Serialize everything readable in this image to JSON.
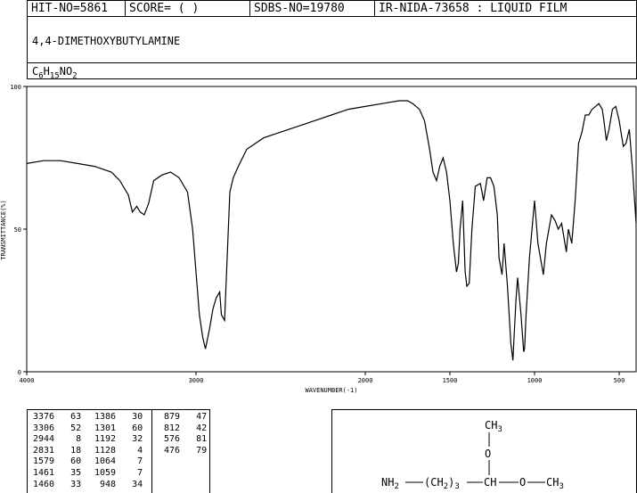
{
  "header": {
    "hit_no": "HIT-NO=5861",
    "score": "SCORE=  (   )",
    "sdbs_no": "SDBS-NO=19780",
    "ir_nida": "IR-NIDA-73658 : LIQUID FILM"
  },
  "compound": {
    "name": "4,4-DIMETHOXYBUTYLAMINE",
    "formula": {
      "C": "C",
      "c_n": "6",
      "H": "H",
      "h_n": "15",
      "N": "N",
      "O": "O",
      "o_n": "2"
    }
  },
  "chart_data": {
    "type": "line",
    "xlabel": "WAVENUMBER(-1)",
    "ylabel": "TRANSMITTANCE(%)",
    "xlim": [
      4000,
      400
    ],
    "ylim": [
      0,
      100
    ],
    "x_ticks": [
      4000,
      3000,
      2000,
      1500,
      1000,
      500
    ],
    "y_ticks": [
      0,
      50,
      100
    ],
    "series": [
      {
        "x": [
          4000,
          3900,
          3800,
          3700,
          3600,
          3500,
          3450,
          3400,
          3376,
          3350,
          3330,
          3306,
          3280,
          3250,
          3200,
          3150,
          3100,
          3050,
          3020,
          3000,
          2980,
          2960,
          2944,
          2920,
          2900,
          2880,
          2860,
          2850,
          2831,
          2800,
          2780,
          2750,
          2700,
          2600,
          2500,
          2400,
          2300,
          2200,
          2100,
          2000,
          1900,
          1800,
          1750,
          1720,
          1700,
          1680,
          1650,
          1620,
          1600,
          1579,
          1560,
          1540,
          1520,
          1500,
          1480,
          1461,
          1450,
          1440,
          1425,
          1410,
          1400,
          1386,
          1370,
          1350,
          1320,
          1301,
          1280,
          1260,
          1240,
          1220,
          1210,
          1192,
          1180,
          1160,
          1140,
          1128,
          1110,
          1100,
          1080,
          1064,
          1059,
          1050,
          1030,
          1000,
          980,
          948,
          930,
          900,
          879,
          860,
          840,
          812,
          800,
          780,
          760,
          740,
          720,
          700,
          680,
          660,
          640,
          620,
          600,
          590,
          576,
          560,
          540,
          520,
          500,
          476,
          460,
          440,
          420,
          400
        ],
        "y": [
          73,
          74,
          74,
          73,
          72,
          70,
          67,
          62,
          56,
          58,
          56,
          55,
          59,
          67,
          69,
          70,
          68,
          63,
          50,
          35,
          20,
          12,
          8,
          15,
          22,
          26,
          28,
          20,
          18,
          63,
          68,
          72,
          78,
          82,
          84,
          86,
          88,
          90,
          92,
          93,
          94,
          95,
          95,
          94,
          93,
          92,
          88,
          78,
          70,
          67,
          72,
          75,
          70,
          60,
          45,
          35,
          38,
          50,
          60,
          35,
          30,
          31,
          50,
          65,
          66,
          60,
          68,
          68,
          65,
          55,
          40,
          34,
          45,
          30,
          10,
          4,
          25,
          33,
          20,
          7,
          8,
          20,
          40,
          60,
          45,
          34,
          45,
          55,
          53,
          50,
          52,
          42,
          50,
          45,
          60,
          80,
          84,
          90,
          90,
          92,
          93,
          94,
          92,
          88,
          81,
          85,
          92,
          93,
          88,
          79,
          80,
          85,
          70,
          52
        ]
      }
    ],
    "peaks": [
      {
        "wavenumber": 3376,
        "t": 63
      },
      {
        "wavenumber": 3306,
        "t": 52
      },
      {
        "wavenumber": 2944,
        "t": 8
      },
      {
        "wavenumber": 2831,
        "t": 18
      },
      {
        "wavenumber": 1579,
        "t": 60
      },
      {
        "wavenumber": 1461,
        "t": 35
      },
      {
        "wavenumber": 1460,
        "t": 33
      },
      {
        "wavenumber": 1386,
        "t": 30
      },
      {
        "wavenumber": 1301,
        "t": 60
      },
      {
        "wavenumber": 1192,
        "t": 32
      },
      {
        "wavenumber": 1128,
        "t": 4
      },
      {
        "wavenumber": 1064,
        "t": 7
      },
      {
        "wavenumber": 1059,
        "t": 7
      },
      {
        "wavenumber": 948,
        "t": 34
      },
      {
        "wavenumber": 879,
        "t": 47
      },
      {
        "wavenumber": 812,
        "t": 42
      },
      {
        "wavenumber": 576,
        "t": 81
      },
      {
        "wavenumber": 476,
        "t": 79
      }
    ]
  },
  "structure": {
    "top_group": "CH",
    "top_sub": "3",
    "oxygen": "O",
    "nh": "NH",
    "nh_sub": "2",
    "chain_open": "(",
    "chain": "CH",
    "chain_sub": "2",
    "chain_close": ")",
    "chain_n": "3",
    "ch": "CH",
    "o2": "O",
    "ch3": "CH",
    "ch3_sub": "3"
  }
}
